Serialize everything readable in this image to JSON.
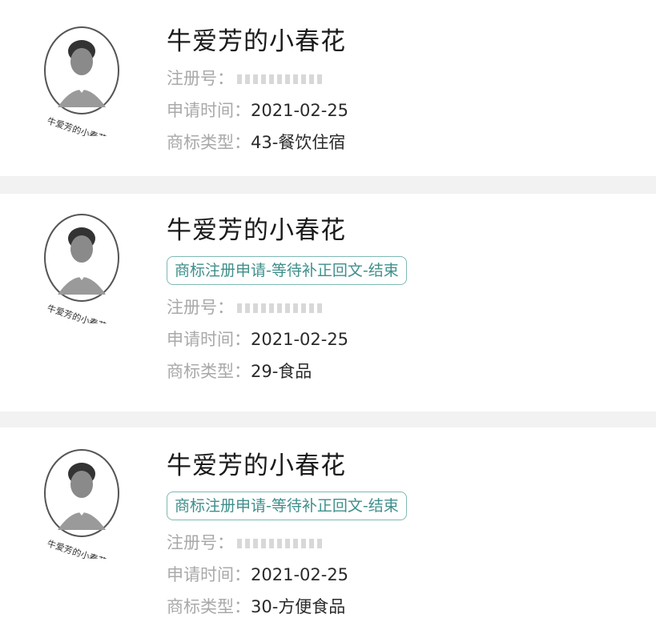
{
  "labels": {
    "reg_no": "注册号：",
    "apply_date": "申请时间：",
    "tm_type": "商标类型："
  },
  "items": [
    {
      "name": "牛爱芳的小春花",
      "status": "",
      "reg_no": "",
      "apply_date": "2021-02-25",
      "category": "43-餐饮住宿"
    },
    {
      "name": "牛爱芳的小春花",
      "status": "商标注册申请-等待补正回文-结束",
      "reg_no": "",
      "apply_date": "2021-02-25",
      "category": "29-食品"
    },
    {
      "name": "牛爱芳的小春花",
      "status": "商标注册申请-等待补正回文-结束",
      "reg_no": "",
      "apply_date": "2021-02-25",
      "category": "30-方便食品"
    }
  ],
  "logo": {
    "icon": "trademark-logo-portrait",
    "signature_text": "牛爱芳的小春花"
  }
}
